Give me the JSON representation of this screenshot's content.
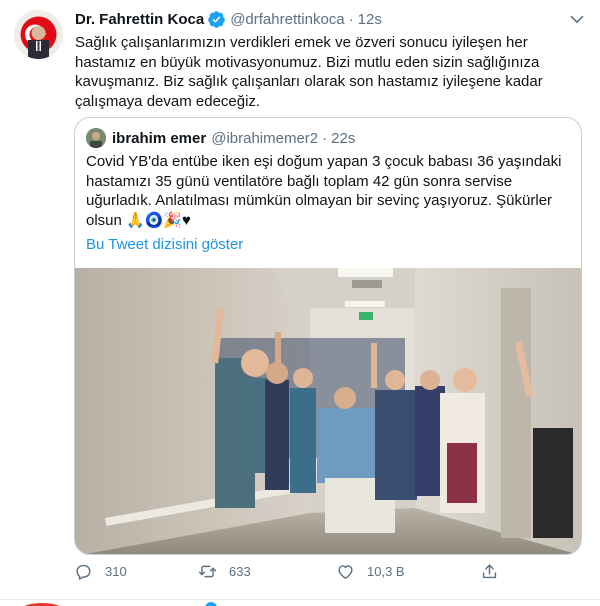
{
  "tweet": {
    "name": "Dr. Fahrettin Koca",
    "handle": "@drfahrettinkoca",
    "separator": "·",
    "time": "12s",
    "text": "Sağlık çalışanlarımızın verdikleri emek ve özveri sonucu iyileşen her\nhastamız en büyük motivasyonumuz. Bizi mutlu eden sizin sağlığınıza\nkavuşmanız. Biz sağlık çalışanları olarak son hastamız iyileşene kadar\nçalışmaya devam edeceğiz.",
    "verified_icon": "verified-badge-icon",
    "more_icon": "chevron-down-icon"
  },
  "quoted": {
    "name": "ibrahim emer",
    "handle": "@ibrahimemer2",
    "separator": "·",
    "time": "22s",
    "text": "Covid YB'da entübe iken eşi doğum yapan 3 çocuk babası 36 yaşındaki\nhastamızı 35 günü ventilatöre bağlı toplam 42 gün sonra servise\nuğurladık. Anlatılması mümkün olmayan bir sevinç yaşıyoruz. Şükürler\nolsun 🙏🧿🎉♥",
    "thread_link": "Bu Tweet dizisini göster"
  },
  "actions": {
    "reply_count": "310",
    "retweet_count": "633",
    "like_count": "10,3 B",
    "reply_icon": "reply-icon",
    "retweet_icon": "retweet-icon",
    "like_icon": "heart-icon",
    "share_icon": "share-icon"
  },
  "colors": {
    "text": "#0f1419",
    "secondary": "#5b7083",
    "link": "#1b95e0",
    "verified": "#1da1f2",
    "border": "#c4cfd6"
  }
}
